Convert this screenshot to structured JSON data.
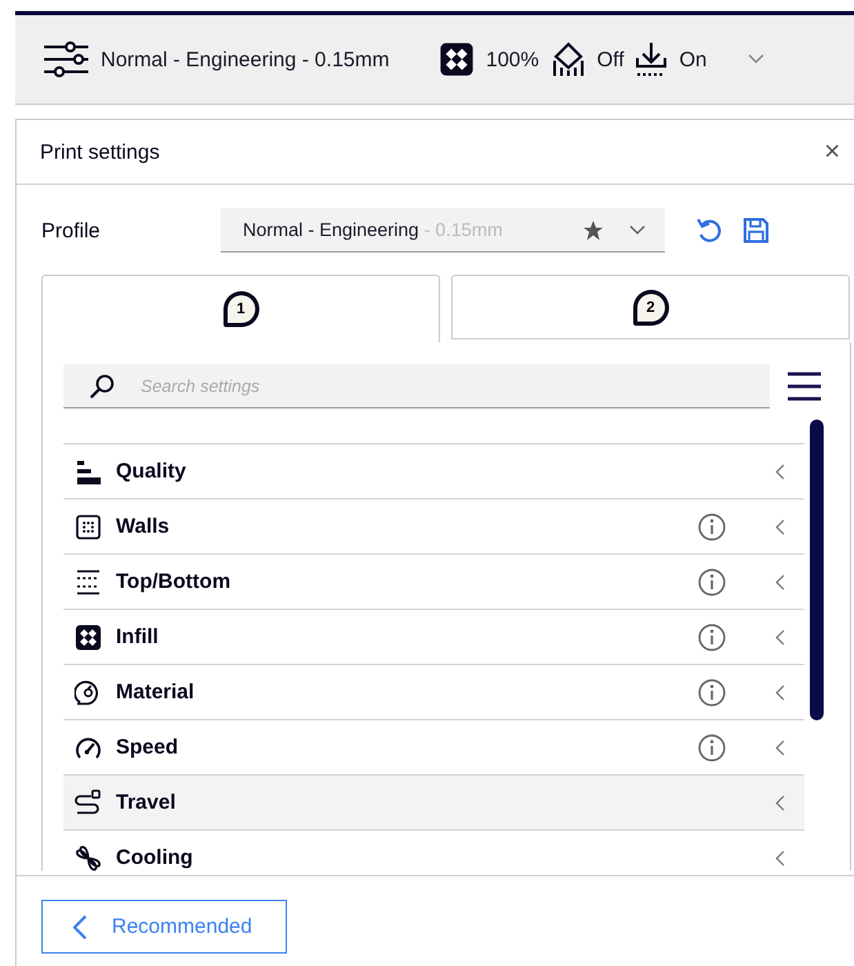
{
  "top_bar": {
    "profile": "Normal - Engineering - 0.15mm",
    "infill": "100%",
    "support": "Off",
    "adhesion": "On"
  },
  "panel": {
    "title": "Print settings",
    "close": "×",
    "profile_label": "Profile",
    "profile_name": "Normal - Engineering",
    "profile_suffix": " - 0.15mm",
    "tabs": [
      {
        "label": "1",
        "selected": true
      },
      {
        "label": "2",
        "selected": false
      }
    ],
    "search": {
      "placeholder": "Search settings"
    },
    "categories": [
      {
        "kind": "quality",
        "label": "Quality",
        "info": false,
        "hovered": false
      },
      {
        "kind": "walls",
        "label": "Walls",
        "info": true,
        "hovered": false
      },
      {
        "kind": "topbottom",
        "label": "Top/Bottom",
        "info": true,
        "hovered": false
      },
      {
        "kind": "infill",
        "label": "Infill",
        "info": true,
        "hovered": false
      },
      {
        "kind": "material",
        "label": "Material",
        "info": true,
        "hovered": false
      },
      {
        "kind": "speed",
        "label": "Speed",
        "info": true,
        "hovered": false
      },
      {
        "kind": "travel",
        "label": "Travel",
        "info": false,
        "hovered": true
      },
      {
        "kind": "cooling",
        "label": "Cooling",
        "info": false,
        "hovered": false
      }
    ],
    "footer_button": "Recommended"
  }
}
